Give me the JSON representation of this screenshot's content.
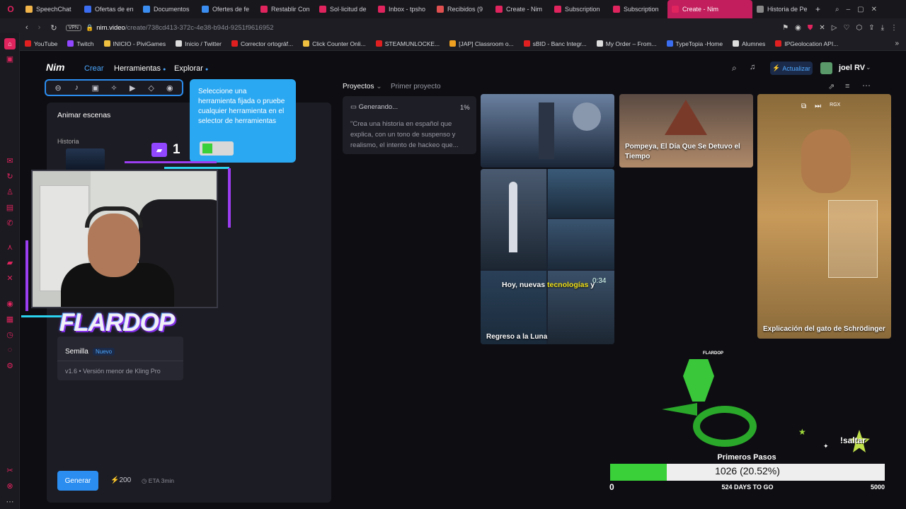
{
  "browser": {
    "tabs": [
      {
        "label": "SpeechChat",
        "color": "#f0b44a"
      },
      {
        "label": "Ofertas de en",
        "color": "#3b6df0"
      },
      {
        "label": "Documentos",
        "color": "#3b8df0"
      },
      {
        "label": "Ofertes de fe",
        "color": "#3b8df0"
      },
      {
        "label": "Restablir Con",
        "color": "#e0245e"
      },
      {
        "label": "Sol·licitud de",
        "color": "#e0245e"
      },
      {
        "label": "Inbox - tpsho",
        "color": "#e0245e"
      },
      {
        "label": "Recibidos (9",
        "color": "#e05050"
      },
      {
        "label": "Create - Nim",
        "color": "#e0245e"
      },
      {
        "label": "Subscription",
        "color": "#e0245e"
      },
      {
        "label": "Subscription",
        "color": "#e0245e"
      },
      {
        "label": "Create - Nim",
        "color": "#e0245e",
        "active": true
      },
      {
        "label": "Historia de Pe",
        "color": "#888888"
      }
    ],
    "url_host": "nim.video",
    "url_path": "/create/738cd413-372c-4e38-b94d-9251f9616952",
    "vpn": "VPN",
    "bookmarks": [
      {
        "label": "YouTube",
        "color": "#e02020"
      },
      {
        "label": "Twitch",
        "color": "#9146ff"
      },
      {
        "label": "INICIO - PiviGames",
        "color": "#f0c040"
      },
      {
        "label": "Inicio / Twitter",
        "color": "#dddddd"
      },
      {
        "label": "Corrector ortográf...",
        "color": "#e02020"
      },
      {
        "label": "Click Counter Onli...",
        "color": "#f0c040"
      },
      {
        "label": "STEAMUNLOCKE...",
        "color": "#e02020"
      },
      {
        "label": "[JAP] Classroom o...",
        "color": "#f0a020"
      },
      {
        "label": "sBID - Banc Integr...",
        "color": "#e02020"
      },
      {
        "label": "My Order – From...",
        "color": "#dddddd"
      },
      {
        "label": "TypeTopia -Home",
        "color": "#3b6df0"
      },
      {
        "label": "Alumnes",
        "color": "#dddddd"
      },
      {
        "label": "IPGeolocation API...",
        "color": "#e02020"
      }
    ]
  },
  "app": {
    "logo": "Nim",
    "nav": {
      "create": "Crear",
      "tools": "Herramientas",
      "explore": "Explorar"
    },
    "upgrade": "Actualizar",
    "user": "joel RV",
    "tooltip": "Seleccione una herramienta fijada o pruebe cualquier herramienta en el selector de herramientas",
    "panel_title": "Animar escenas",
    "history_label": "Historia",
    "model_name": "Semilla",
    "model_badge": "Nuevo",
    "model_desc": "v1.6 • Versión menor de Kling Pro",
    "generate_label": "Generar",
    "credits": "200",
    "eta": "ETA 3min",
    "projects_label": "Proyectos",
    "project_name": "Primer proyecto",
    "generating_label": "Generando...",
    "generating_pct": "1%",
    "prompt_preview": "\"Crea una historia en español que explica, con un tono de suspenso y realismo, el intento de hackeo que...",
    "card_pompeya": "Pompeya, El Día Que Se Detuvo el Tiempo",
    "card_luna": "Regreso a la Luna",
    "card_gato": "Explicación del gato de Schrödinger",
    "subtitle_plain": "Hoy, nuevas ",
    "subtitle_highlight": "tecnologías",
    "subtitle_end": " y",
    "timer": "0:34"
  },
  "overlay": {
    "twitch_count": "1",
    "logo_text": "FLARDOP",
    "small_logo": "FLARDOP",
    "saltar": "!saltar",
    "goal_title": "Primeros Pasos",
    "progress_text": "1026 (20.52%)",
    "progress_fraction": 0.2052,
    "progress_min": "0",
    "progress_max": "5000",
    "days_left": "524 DAYS TO GO"
  },
  "colors": {
    "accent": "#2b8df0",
    "brand": "#e0245e",
    "progress": "#3ad03a"
  }
}
